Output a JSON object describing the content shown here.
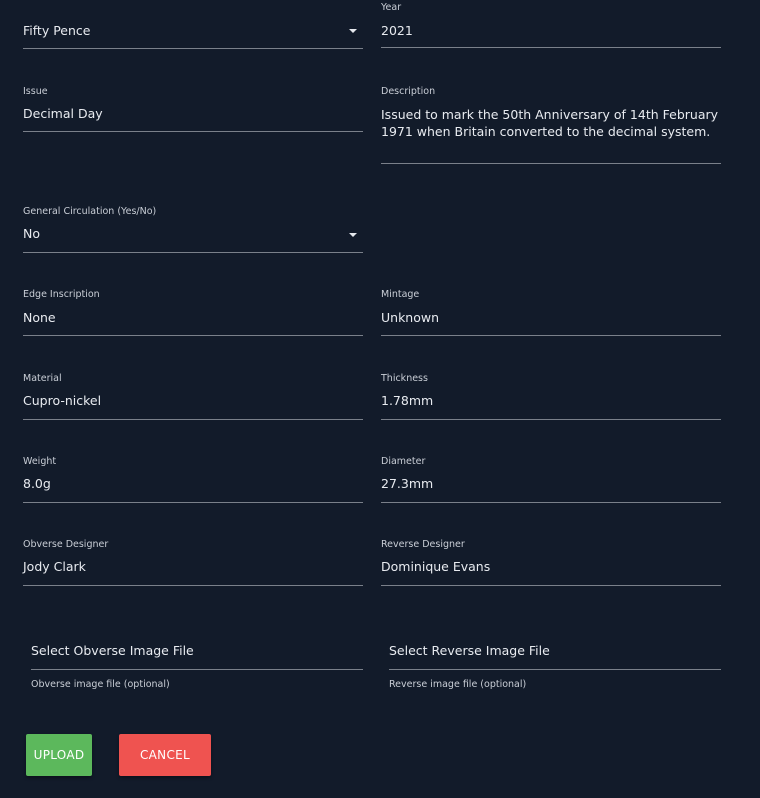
{
  "form": {
    "denomination": {
      "value": "Fifty Pence"
    },
    "year": {
      "label": "Year",
      "value": "2021"
    },
    "issue": {
      "label": "Issue",
      "value": "Decimal Day"
    },
    "description": {
      "label": "Description",
      "value": "Issued to mark the 50th Anniversary of 14th February 1971 when Britain converted to the decimal system."
    },
    "general_circulation": {
      "label": "General Circulation (Yes/No)",
      "value": "No"
    },
    "edge_inscription": {
      "label": "Edge Inscription",
      "value": "None"
    },
    "mintage": {
      "label": "Mintage",
      "value": "Unknown"
    },
    "material": {
      "label": "Material",
      "value": "Cupro-nickel"
    },
    "thickness": {
      "label": "Thickness",
      "value": "1.78mm"
    },
    "weight": {
      "label": "Weight",
      "value": "8.0g"
    },
    "diameter": {
      "label": "Diameter",
      "value": "27.3mm"
    },
    "obverse_designer": {
      "label": "Obverse Designer",
      "value": "Jody Clark"
    },
    "reverse_designer": {
      "label": "Reverse Designer",
      "value": "Dominique Evans"
    },
    "obverse_file": {
      "placeholder": "Select Obverse Image File",
      "hint": "Obverse image file (optional)"
    },
    "reverse_file": {
      "placeholder": "Select Reverse Image File",
      "hint": "Reverse image file (optional)"
    }
  },
  "actions": {
    "upload_label": "UPLOAD",
    "cancel_label": "CANCEL"
  },
  "icons": {
    "dropdown": "caret-down-icon"
  },
  "colors": {
    "background": "#121b2a",
    "upload": "#5cb85c",
    "cancel": "#ef5350",
    "underline": "#7a808a"
  }
}
